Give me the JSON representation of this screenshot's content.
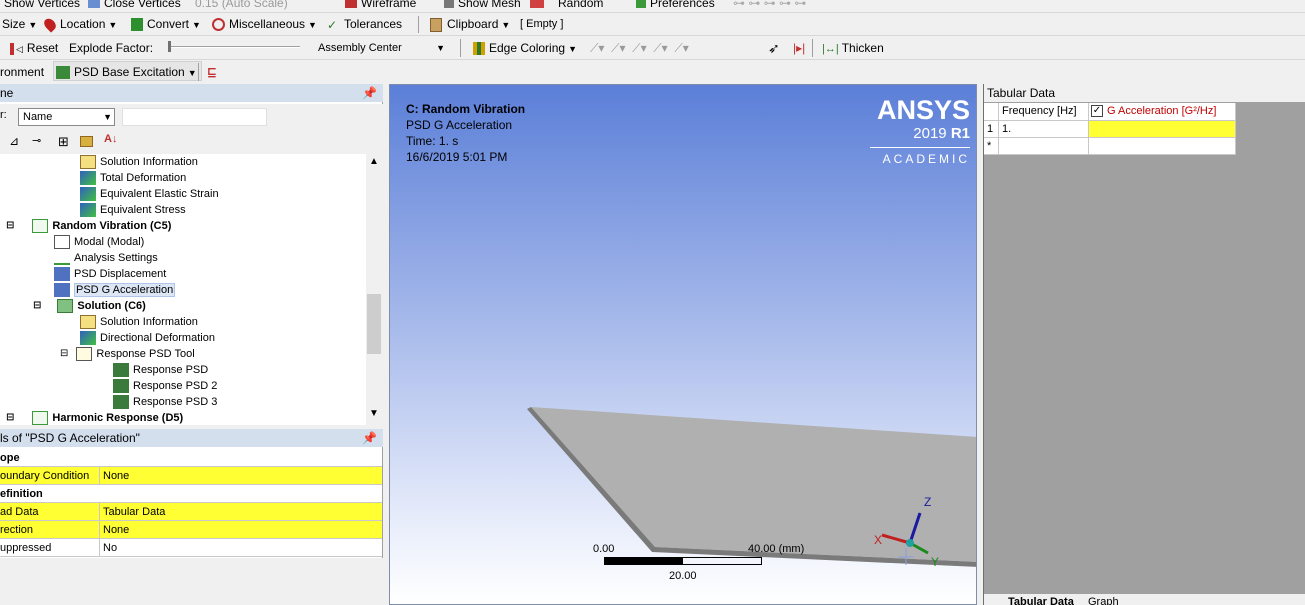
{
  "toolbar1": {
    "show_vertices": "Show Vertices",
    "close_vertices": "Close Vertices",
    "auto_scale": "0.15 (Auto Scale)",
    "wireframe": "Wireframe",
    "show_mesh": "Show Mesh",
    "random": "Random",
    "preferences": "Preferences"
  },
  "toolbar2": {
    "size": "Size",
    "location": "Location",
    "convert": "Convert",
    "miscellaneous": "Miscellaneous",
    "tolerances": "Tolerances",
    "clipboard": "Clipboard",
    "empty": "[ Empty ]"
  },
  "toolbar3": {
    "reset": "Reset",
    "explode_factor": "Explode Factor:",
    "assembly_center": "Assembly Center",
    "edge_coloring": "Edge Coloring",
    "thicken": "Thicken"
  },
  "toolbar4": {
    "environment": "ronment",
    "psd_base_excitation": "PSD Base Excitation"
  },
  "outline": {
    "title": "ne",
    "filter_label": "r:",
    "filter_value": "Name",
    "items": [
      {
        "label": "Solution Information",
        "indent": 1
      },
      {
        "label": "Total Deformation",
        "indent": 1
      },
      {
        "label": "Equivalent Elastic Strain",
        "indent": 1
      },
      {
        "label": "Equivalent Stress",
        "indent": 1
      },
      {
        "label": "Random Vibration (C5)",
        "indent": 0
      },
      {
        "label": "Modal (Modal)",
        "indent": 0
      },
      {
        "label": "Analysis Settings",
        "indent": 0
      },
      {
        "label": "PSD Displacement",
        "indent": 0
      },
      {
        "label": "PSD G Acceleration",
        "indent": 0
      },
      {
        "label": "Solution (C6)",
        "indent": 0
      },
      {
        "label": "Solution Information",
        "indent": 1
      },
      {
        "label": "Directional Deformation",
        "indent": 1
      },
      {
        "label": "Response PSD Tool",
        "indent": 1
      },
      {
        "label": "Response PSD",
        "indent": 2
      },
      {
        "label": "Response PSD 2",
        "indent": 2
      },
      {
        "label": "Response PSD 3",
        "indent": 2
      },
      {
        "label": "Harmonic Response (D5)",
        "indent": 0
      }
    ]
  },
  "details": {
    "title": "ls of \"PSD G Acceleration\"",
    "rows": [
      {
        "key": "ope",
        "value": "",
        "type": "group"
      },
      {
        "key": "oundary Condition",
        "value": "None",
        "type": "yellow"
      },
      {
        "key": "efinition",
        "value": "",
        "type": "group"
      },
      {
        "key": "ad Data",
        "value": "Tabular Data",
        "type": "yellow"
      },
      {
        "key": "rection",
        "value": "None",
        "type": "yellow"
      },
      {
        "key": "uppressed",
        "value": "No",
        "type": "white"
      }
    ]
  },
  "viewport": {
    "header_title": "C: Random Vibration",
    "header_sub": "PSD G Acceleration",
    "header_time": "Time: 1. s",
    "header_date": "16/6/2019 5:01 PM",
    "brand": "ANSYS",
    "version_year": "2019",
    "version_rel": "R1",
    "edition": "ACADEMIC",
    "scale_min": "0.00",
    "scale_mid": "20.00",
    "scale_max": "40.00 (mm)",
    "axis_x": "X",
    "axis_y": "Y",
    "axis_z": "Z"
  },
  "tabular": {
    "title": "Tabular Data",
    "col1": "Frequency [Hz]",
    "col2": "G Acceleration [G²/Hz]",
    "row1_index": "1",
    "row1_freq": "1.",
    "row2_index": "*",
    "tab_label": "Tabular Data",
    "graph_label": "Graph"
  },
  "colors": {
    "accent_yellow": "#ffff33",
    "viewport_top": "#5b7fd8",
    "viewport_bottom": "#ffffff"
  }
}
